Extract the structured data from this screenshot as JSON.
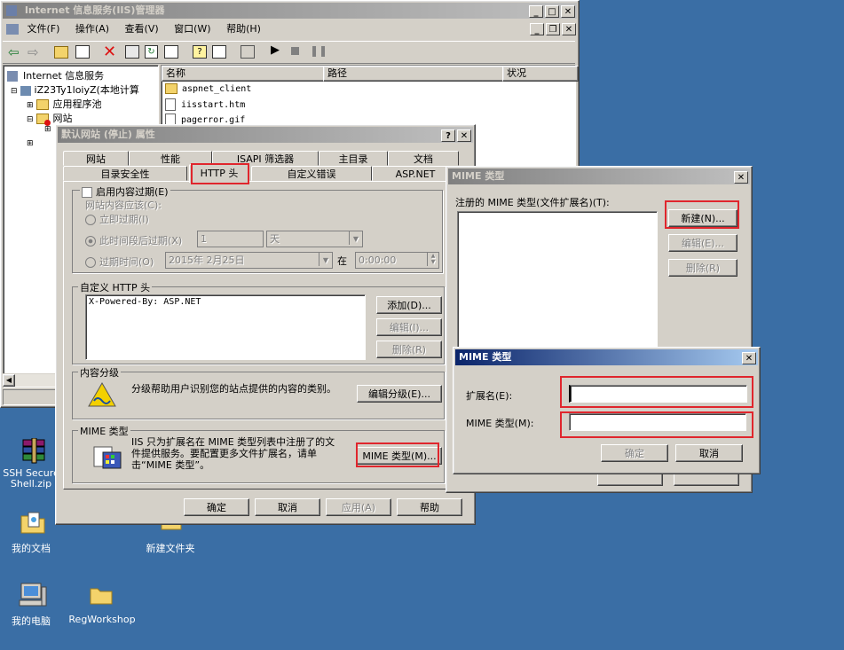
{
  "desktop": {
    "icons": [
      {
        "label": "SSH Secure Shell.zip"
      },
      {
        "label": "我的文档"
      },
      {
        "label": "新建文件夹"
      },
      {
        "label": "我的电脑"
      },
      {
        "label": "RegWorkshop"
      }
    ]
  },
  "iis": {
    "title": "Internet 信息服务(IIS)管理器",
    "menu": [
      "文件(F)",
      "操作(A)",
      "查看(V)",
      "窗口(W)",
      "帮助(H)"
    ],
    "tree": [
      "Internet 信息服务",
      "iZ23Ty1loiyZ(本地计算",
      "应用程序池",
      "网站"
    ],
    "columns": [
      "名称",
      "路径",
      "状况"
    ],
    "files": [
      "aspnet_client",
      "iisstart.htm",
      "pagerror.gif"
    ]
  },
  "props": {
    "title": "默认网站 (停止) 属性",
    "tabs_back": [
      "网站",
      "性能",
      "ISAPI 筛选器",
      "主目录",
      "文档"
    ],
    "tabs_front": [
      "目录安全性",
      "HTTP 头",
      "自定义错误",
      "ASP.NET"
    ],
    "expire": {
      "enable": "启用内容过期(E)",
      "should": "网站内容应该(C):",
      "now": "立即过期(I)",
      "after": "此时间段后过期(X)",
      "after_value": "1",
      "unit": "天",
      "at": "过期时间(O)",
      "date": "2015年 2月25日",
      "at_label": "在",
      "time": "0:00:00"
    },
    "custom_headers": {
      "label": "自定义 HTTP 头",
      "items": [
        "X-Powered-By: ASP.NET"
      ],
      "add": "添加(D)...",
      "edit": "编辑(I)...",
      "delete": "删除(R)"
    },
    "rating": {
      "label": "内容分级",
      "desc": "分级帮助用户识别您的站点提供的内容的类别。",
      "button": "编辑分级(E)..."
    },
    "mime": {
      "label": "MIME 类型",
      "desc": "IIS 只为扩展名在 MIME 类型列表中注册了的文件提供服务。要配置更多文件扩展名，请单击“MIME 类型”。",
      "button": "MIME 类型(M)..."
    },
    "buttons": [
      "确定",
      "取消",
      "应用(A)",
      "帮助"
    ]
  },
  "mime_list": {
    "title": "MIME 类型",
    "label": "注册的 MIME 类型(文件扩展名)(T):",
    "new": "新建(N)...",
    "edit": "编辑(E)...",
    "delete": "删除(R)"
  },
  "mime_edit": {
    "title": "MIME 类型",
    "ext_label": "扩展名(E):",
    "ext_value": "",
    "type_label": "MIME 类型(M):",
    "type_value": "",
    "ok": "确定",
    "cancel": "取消"
  },
  "colors": {
    "desktop": "#3a6ea5",
    "highlight": "#e0262d",
    "active_title": "#0a246a"
  }
}
